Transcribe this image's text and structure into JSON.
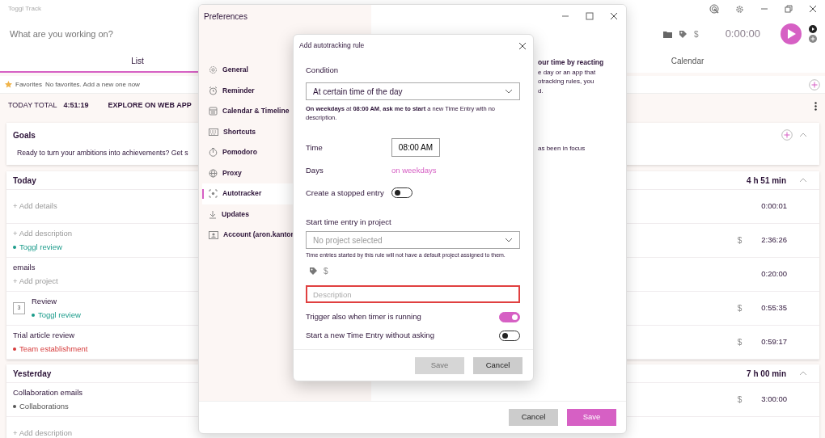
{
  "app": {
    "title": "Toggl Track",
    "timer": {
      "placeholder": "What are you working on?",
      "billable_sign": "$",
      "duration": "0:00:00"
    },
    "tabs": [
      {
        "label": "List",
        "selected": true
      },
      {
        "label": "Calendar",
        "selected": false
      }
    ],
    "favorites": {
      "label": "Favorites",
      "empty_text": "No favorites. Add a new one now"
    },
    "summary": {
      "label": "TODAY TOTAL",
      "total": "4:51:19",
      "link": "EXPLORE ON WEB APP"
    },
    "goals": {
      "title": "Goals",
      "text": "Ready to turn your ambitions into achievements? Get s",
      "expanded": true
    },
    "groups": [
      {
        "title": "Today",
        "total": "4 h 51 min",
        "expanded": true,
        "entries": [
          {
            "description": "+ Add details",
            "description_is_placeholder": true,
            "duration": "0:00:01"
          },
          {
            "description": "+ Add description",
            "description_is_placeholder": true,
            "project": {
              "name": "Toggl review",
              "color": "#1a9b8a"
            },
            "billable_sign": "$",
            "duration": "2:36:26"
          },
          {
            "description": "emails",
            "description_is_placeholder": false,
            "add_project": "+ Add project",
            "duration": "0:20:00"
          },
          {
            "count": "3",
            "description": "Review",
            "description_is_placeholder": false,
            "project": {
              "name": "Toggl review",
              "color": "#1a9b8a"
            },
            "billable_sign": "$",
            "duration": "0:55:35"
          },
          {
            "description": "Trial article review",
            "description_is_placeholder": false,
            "project": {
              "name": "Team establishment",
              "color": "#d63c3c"
            },
            "billable_sign": "$",
            "duration": "0:59:17"
          }
        ]
      },
      {
        "title": "Yesterday",
        "total": "7 h 00 min",
        "expanded": true,
        "entries": [
          {
            "description": "Collaboration emails",
            "description_is_placeholder": false,
            "project": {
              "name": "Collaborations",
              "color": "#555555"
            },
            "billable_sign": "$",
            "duration": "3:00:00"
          },
          {
            "description": "+ Add description",
            "description_is_placeholder": true
          }
        ]
      }
    ]
  },
  "preferences": {
    "title": "Preferences",
    "sidebar": [
      {
        "label": "General",
        "selected": false
      },
      {
        "label": "Reminder",
        "selected": false
      },
      {
        "label": "Calendar & Timeline",
        "selected": false
      },
      {
        "label": "Shortcuts",
        "selected": false
      },
      {
        "label": "Pomodoro",
        "selected": false
      },
      {
        "label": "Proxy",
        "selected": false
      },
      {
        "label": "Autotracker",
        "selected": true
      },
      {
        "label": "Updates",
        "selected": false
      },
      {
        "label": "Account (aron.kantor",
        "selected": false
      }
    ],
    "intro_lines": [
      {
        "text": "our time by reacting",
        "bold": true
      },
      {
        "text": "e day or an app that",
        "bold": false
      },
      {
        "text": "otracking rules, you",
        "bold": false
      },
      {
        "text": "d.",
        "bold": false
      }
    ],
    "option_text": "as been in focus",
    "buttons": [
      {
        "label": "Cancel",
        "kind": "secondary"
      },
      {
        "label": "Save",
        "kind": "primary"
      }
    ]
  },
  "dialog": {
    "title": "Add autotracking rule",
    "condition_label": "Condition",
    "condition": "At certain time of the day",
    "summary": "**On weekdays** at **08:00 AM**, **ask me to start** a new Time Entry with no description.",
    "time_label": "Time",
    "time": "08:00 AM",
    "days_label": "Days",
    "days": "on weekdays",
    "stopped_entry": {
      "label": "Create a stopped entry",
      "on": false
    },
    "project_label": "Start time entry in project",
    "project_placeholder": "No project selected",
    "project_hint": "Time entries started by this rule will not have a default project assigned to them.",
    "billable_sign": "$",
    "description": {
      "placeholder": "Description",
      "invalid": true
    },
    "options": [
      {
        "label": "Trigger also when timer is running",
        "on": true
      },
      {
        "label": "Start a new Time Entry without asking",
        "on": false
      }
    ],
    "buttons": [
      {
        "label": "Save",
        "disabled": true
      },
      {
        "label": "Cancel",
        "disabled": false
      }
    ]
  }
}
